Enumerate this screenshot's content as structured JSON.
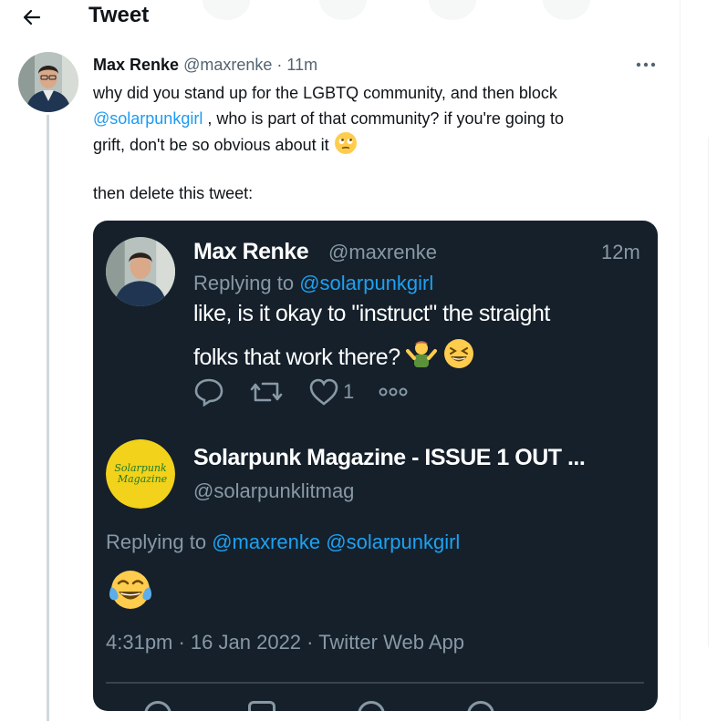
{
  "header": {
    "title": "Tweet",
    "back_icon": "arrow-left-icon"
  },
  "tweet": {
    "author_name": "Max Renke",
    "author_handle": "@maxrenke",
    "separator": "·",
    "time": "11m",
    "more_icon": "more-horizontal-icon",
    "text_line1": "why did you stand up for the LGBTQ community, and then block",
    "mention": "@solarpunkgirl",
    "text_line2_rest": " , who is part of that community? if you're going to",
    "text_line3": "grift, don't be so obvious about it",
    "text_line3_emoji": "face-with-rolling-eyes-emoji",
    "text_para2": "then delete this tweet:"
  },
  "embedded": {
    "reply": {
      "author_name": "Max Renke",
      "author_handle": "@maxrenke",
      "time": "12m",
      "replying_prefix": "Replying to ",
      "replying_to": "@solarpunkgirl",
      "text_line1": "like, is it okay to \"instruct\" the straight",
      "text_line2": "folks that work there?",
      "emojis": [
        "person-shrugging-emoji",
        "grinning-squinting-face-emoji"
      ],
      "actions": {
        "reply_icon": "reply-icon",
        "retweet_icon": "retweet-icon",
        "like_icon": "heart-icon",
        "like_count": "1",
        "more_icon": "more-horizontal-icon"
      }
    },
    "main": {
      "author_name": "Solarpunk Magazine - ISSUE 1 OUT ...",
      "author_handle": "@solarpunklitmag",
      "logo_text_1": "Solarpunk",
      "logo_text_2": "Magazine",
      "replying_prefix": "Replying to ",
      "replying_to_1": "@maxrenke",
      "replying_to_2": "@solarpunkgirl",
      "text_emoji": "face-with-tears-of-joy-emoji",
      "timestamp": "4:31pm · 16 Jan 2022 · Twitter Web App"
    }
  },
  "colors": {
    "accent": "#1d9bf0",
    "text": "#0f1419",
    "muted": "#536471",
    "dark_bg": "#15202b",
    "dark_muted": "#8899a6",
    "thread_line": "#cfd9de"
  }
}
